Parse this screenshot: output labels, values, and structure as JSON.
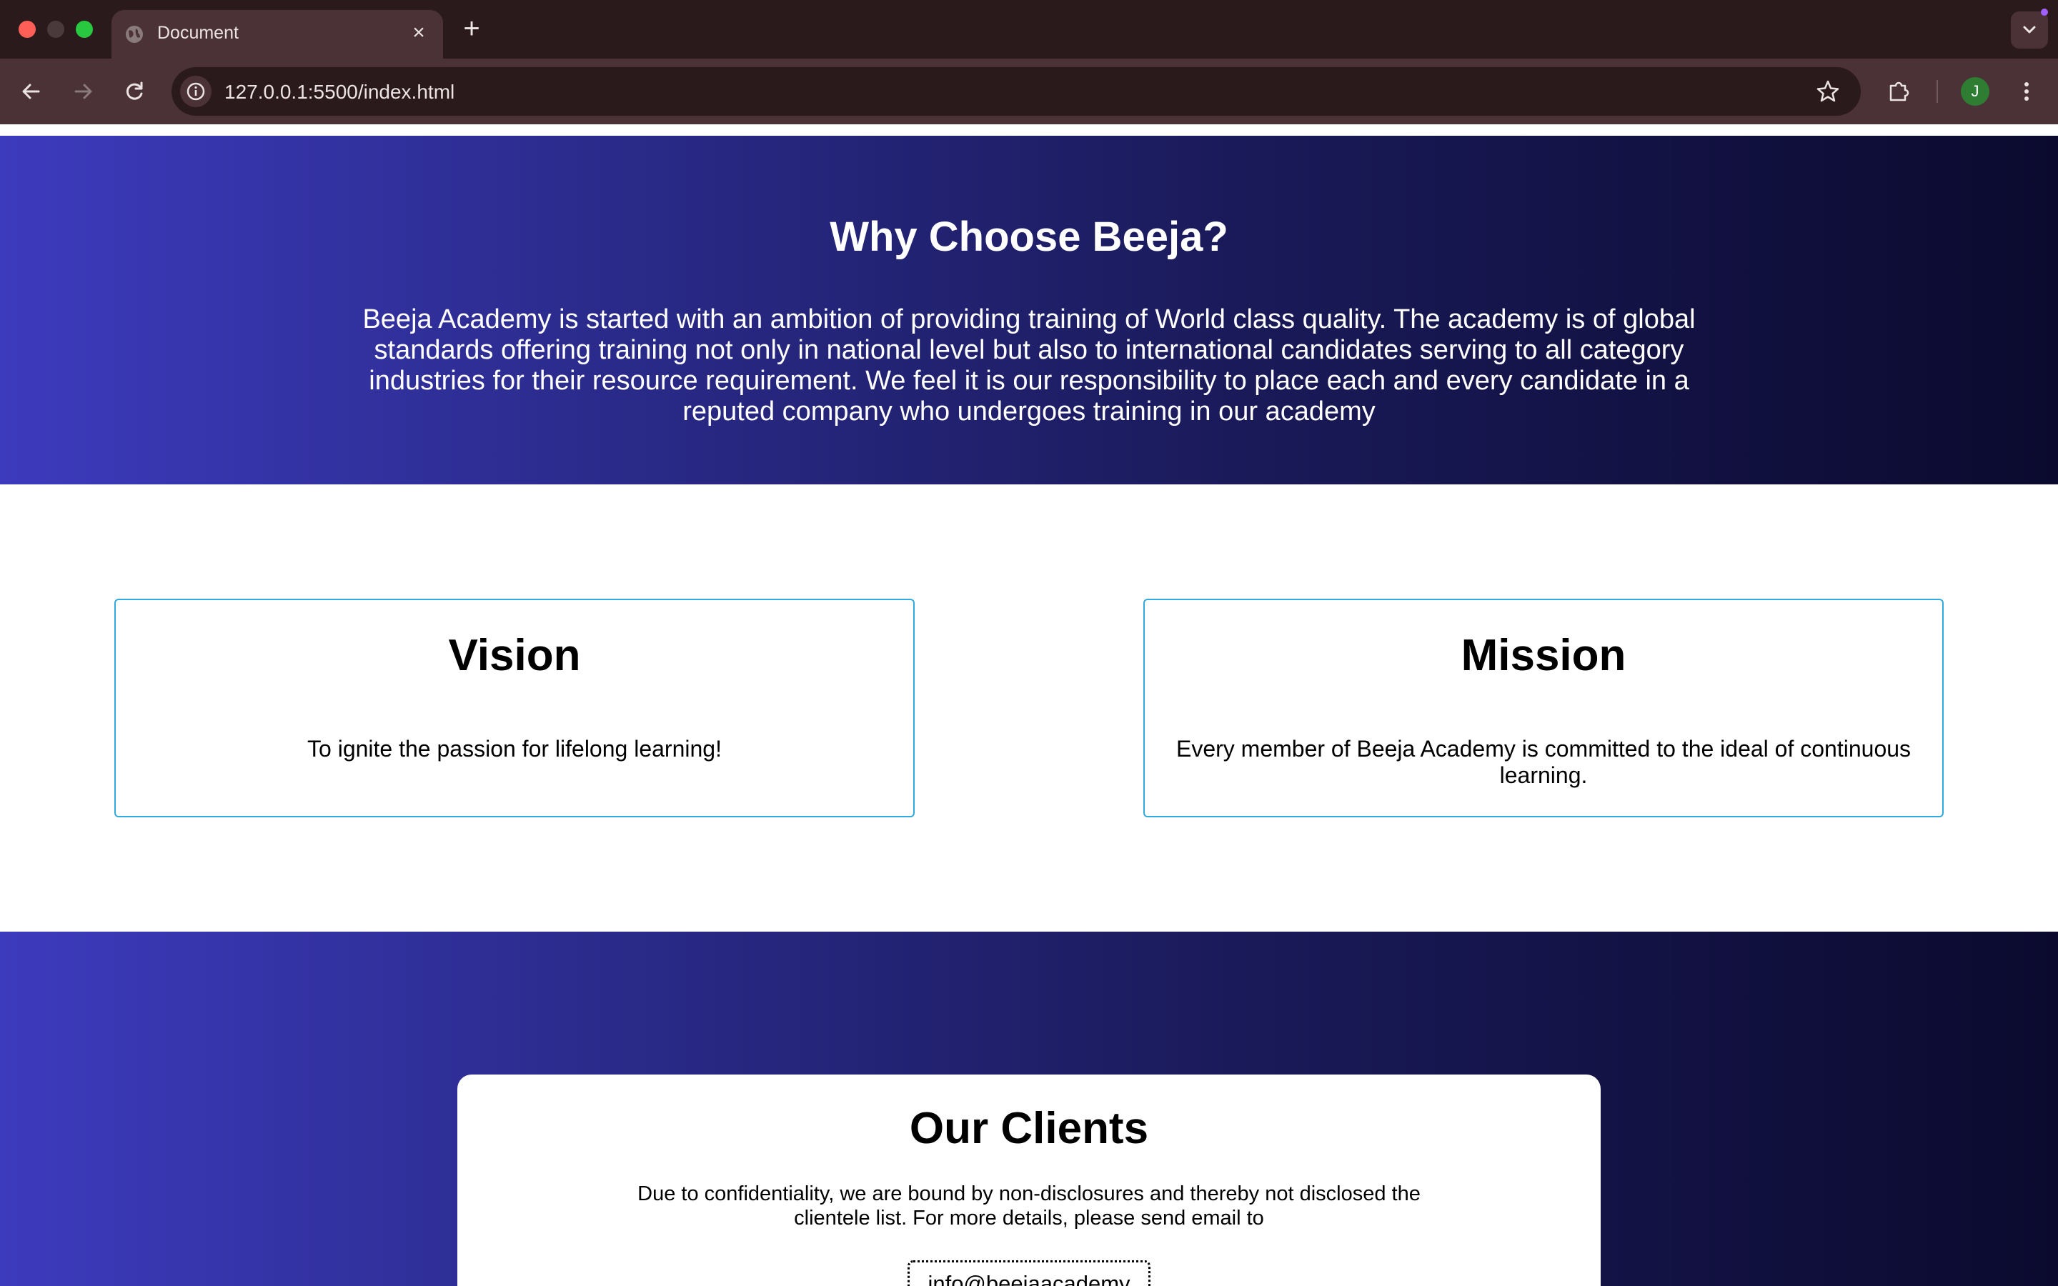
{
  "browser": {
    "tab_title": "Document",
    "tab_close_glyph": "×",
    "new_tab_glyph": "+",
    "url": "127.0.0.1:5500/index.html",
    "profile_initial": "J",
    "icons": [
      "globe-icon",
      "close-icon",
      "plus-icon",
      "chevron-down-icon",
      "back-arrow-icon",
      "forward-arrow-icon",
      "reload-icon",
      "info-icon",
      "star-icon",
      "puzzle-icon",
      "kebab-menu-icon"
    ]
  },
  "why": {
    "title": "Why Choose Beeja?",
    "body": "Beeja Academy is started with an ambition of providing training of World class quality. The academy is of global standards offering training not only in national level but also to international candidates serving to all category industries for their resource requirement. We feel it is our responsibility to place each and every candidate in a reputed company who undergoes training in our academy"
  },
  "vision": {
    "title": "Vision",
    "text": "To ignite the passion for lifelong learning!"
  },
  "mission": {
    "title": "Mission",
    "text": "Every member of Beeja Academy is committed to the ideal of continuous learning."
  },
  "clients": {
    "title": "Our Clients",
    "text": "Due to confidentiality, we are bound by non-disclosures and thereby not disclosed the clientele list. For more details, please send email to",
    "email": "info@beejaacademy"
  },
  "colors": {
    "gradient_start": "#3d3bbd",
    "gradient_end": "#0b0a2e",
    "card_border": "#33aadd",
    "chrome_dark": "#2b1a1c",
    "chrome_toolbar": "#4a3236"
  }
}
